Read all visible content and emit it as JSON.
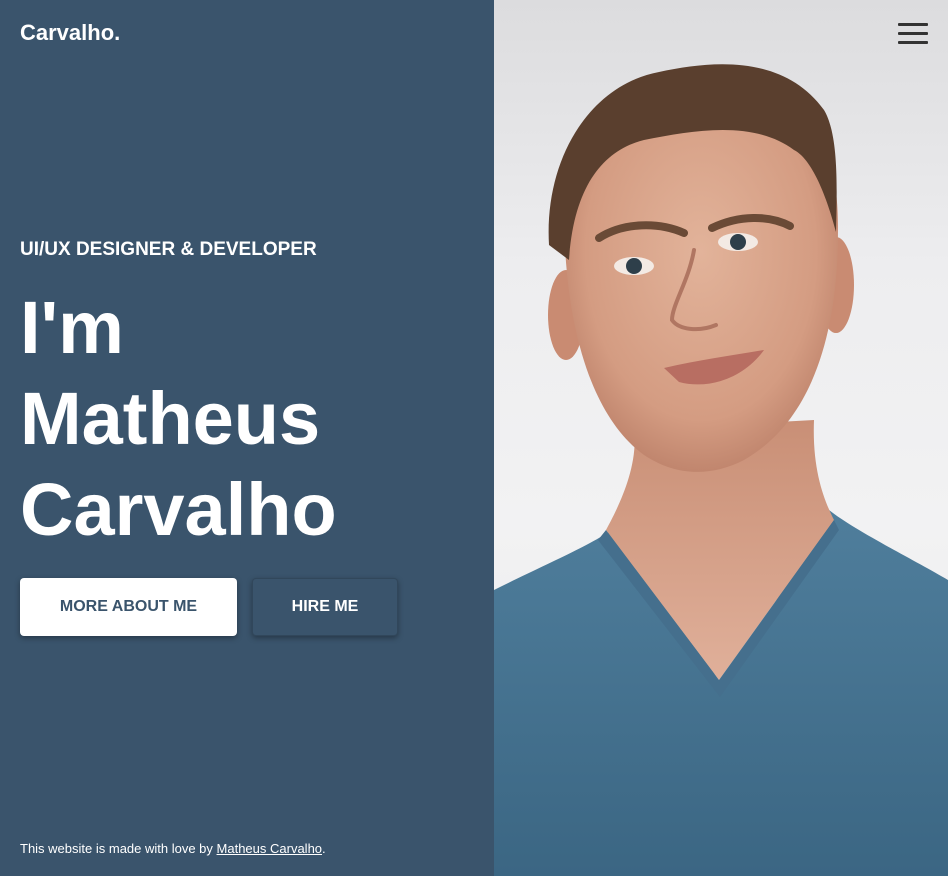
{
  "header": {
    "brand": "Carvalho.",
    "menu_icon": "hamburger-menu-icon"
  },
  "hero": {
    "subtitle": "UI/UX DESIGNER & DEVELOPER",
    "headline_lines": [
      "I'm",
      "Matheus",
      "Carvalho"
    ],
    "primary_button": "MORE ABOUT ME",
    "secondary_button": "HIRE ME"
  },
  "footer": {
    "prefix": "This website is made with love by ",
    "link_text": "Matheus Carvalho",
    "suffix": "."
  },
  "photo": {
    "subject": "portrait"
  },
  "colors": {
    "panel_background": "#3a546c",
    "text": "#ffffff",
    "primary_button_bg": "#ffffff",
    "primary_button_text": "#3a546c"
  }
}
